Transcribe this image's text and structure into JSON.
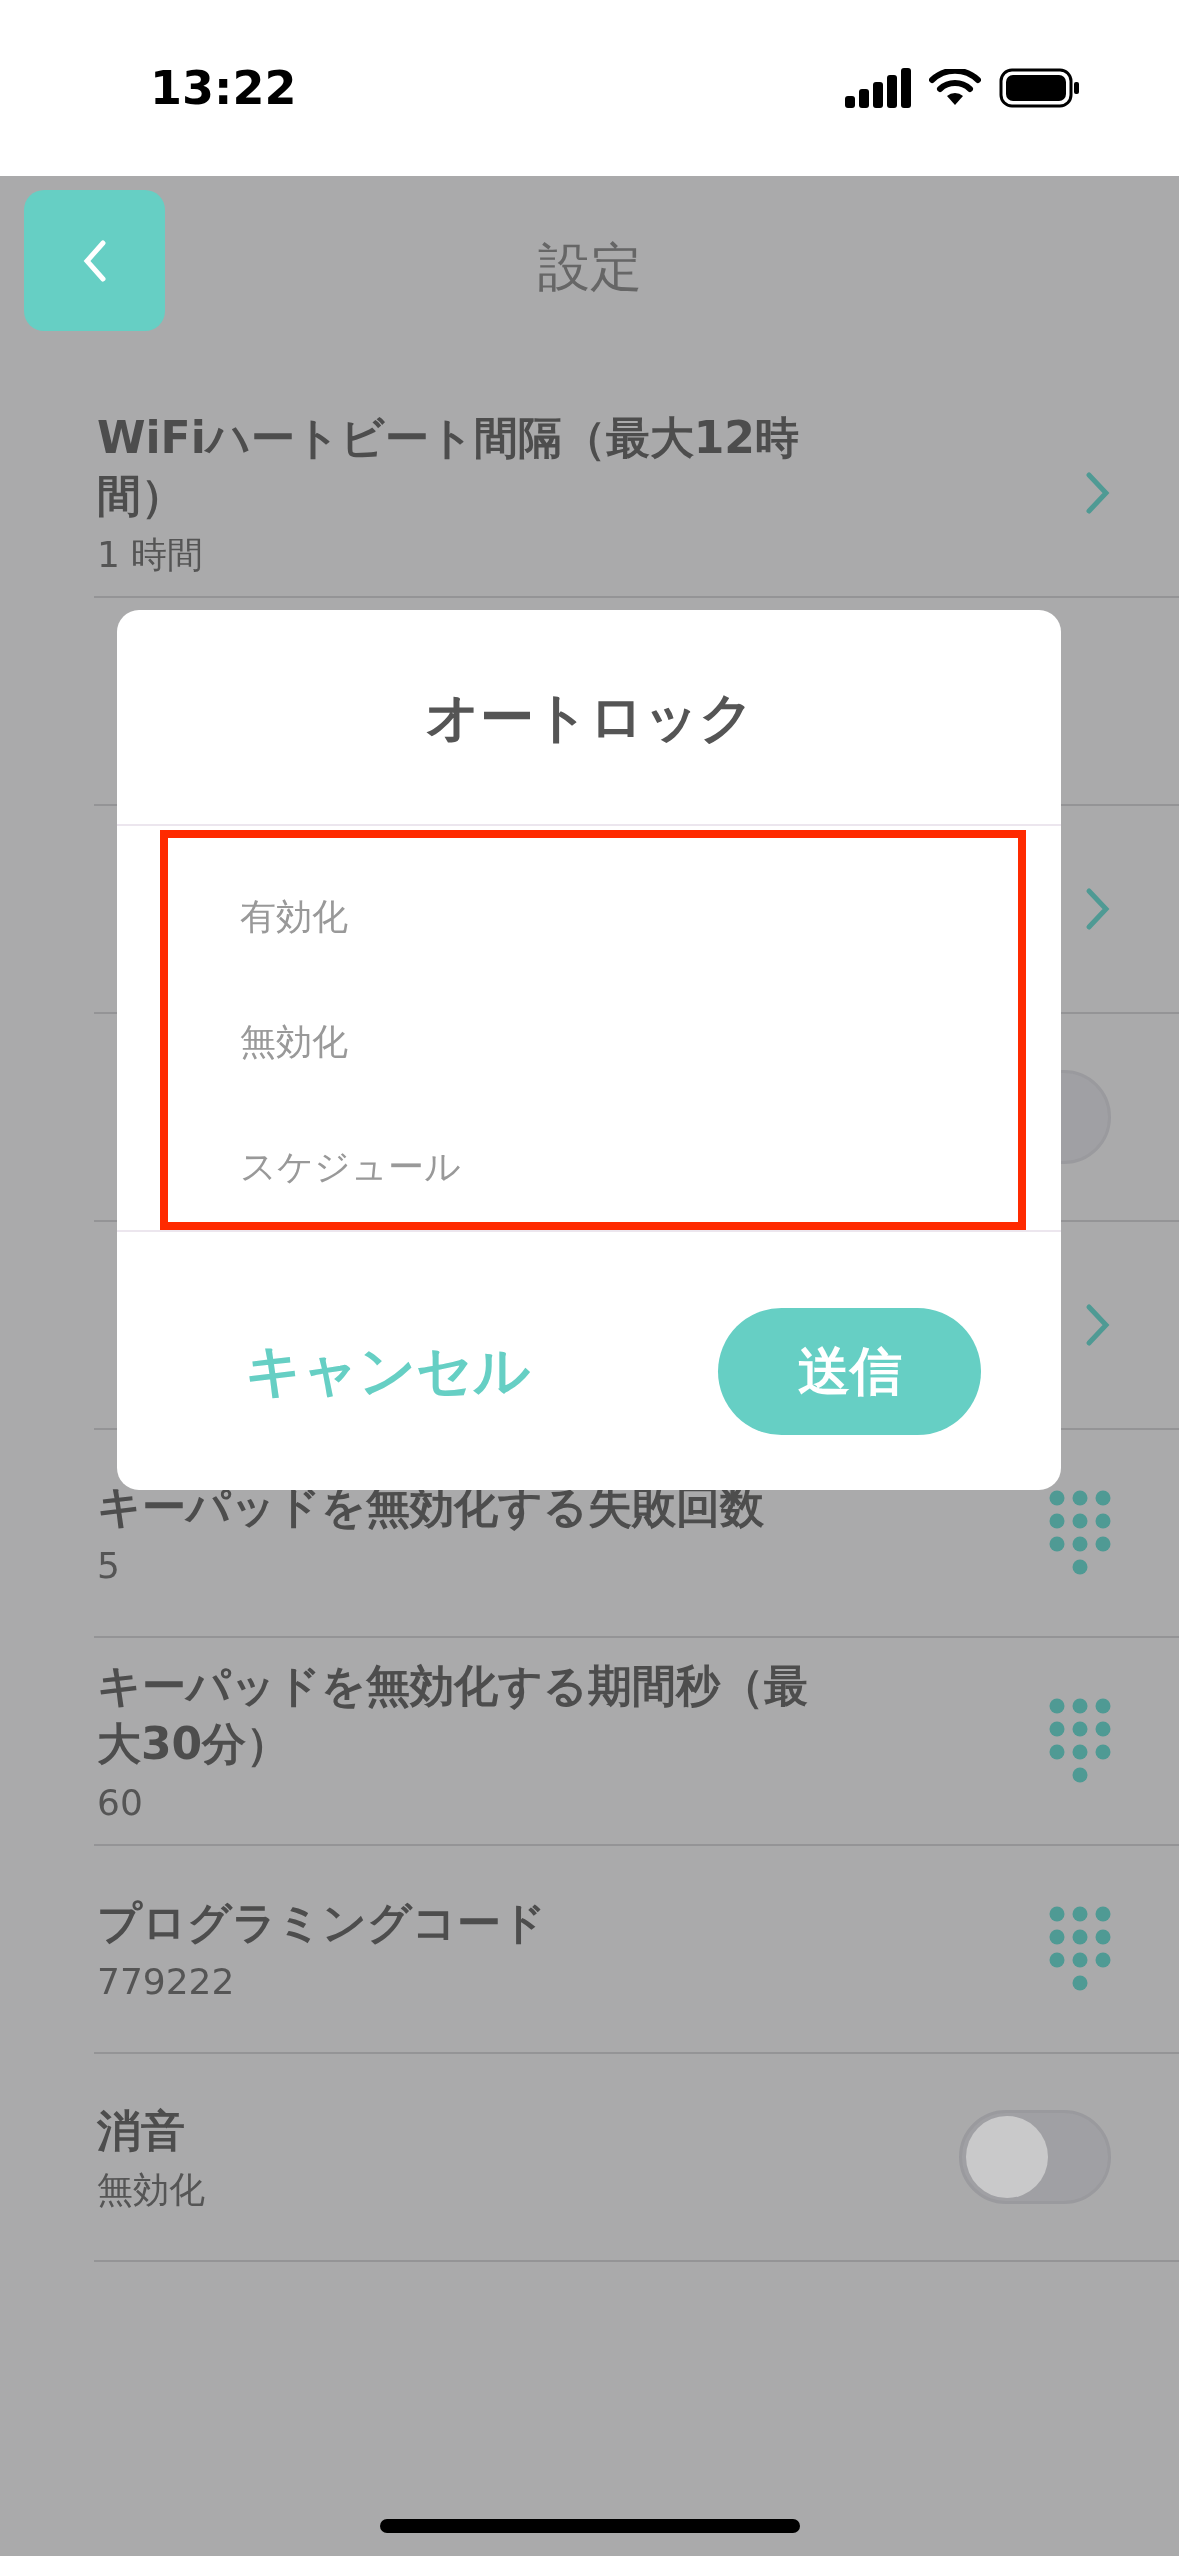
{
  "status_bar": {
    "time": "13:22"
  },
  "header": {
    "title": "設定"
  },
  "settings": [
    {
      "title": "WiFiハートビート間隔（最大12時間）",
      "value": "1 時間",
      "kind": "link"
    },
    {
      "kind": "plain"
    },
    {
      "kind": "link"
    },
    {
      "kind": "toggle",
      "on": false
    },
    {
      "kind": "link"
    },
    {
      "title": "キーパッドを無効化する失敗回数",
      "value": "5",
      "kind": "keypad"
    },
    {
      "title": "キーパッドを無効化する期間秒（最大30分）",
      "value": "60",
      "kind": "keypad"
    },
    {
      "title": "プログラミングコード",
      "value": "779222",
      "kind": "keypad"
    },
    {
      "title": "消音",
      "value": "無効化",
      "kind": "toggle",
      "on": false
    }
  ],
  "dialog": {
    "title": "オートロック",
    "options_highlighted": true,
    "options": [
      {
        "label": "有効化"
      },
      {
        "label": "無効化"
      },
      {
        "label": "スケジュール"
      }
    ],
    "cancel": "キャンセル",
    "submit": "送信"
  }
}
